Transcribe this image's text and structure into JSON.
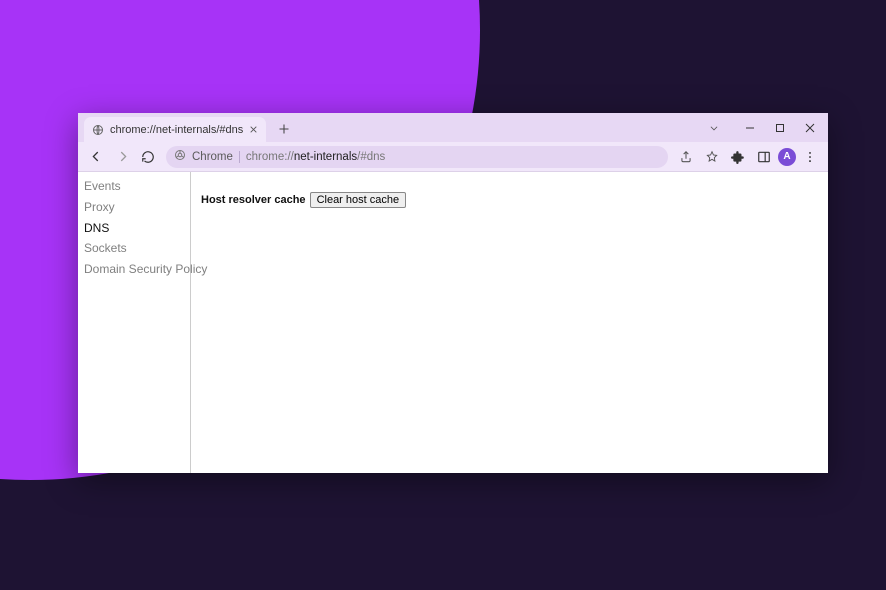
{
  "tab": {
    "title": "chrome://net-internals/#dns"
  },
  "omnibox": {
    "scheme_label": "Chrome",
    "url_prefix": "chrome://",
    "url_host": "net-internals",
    "url_suffix": "/#dns"
  },
  "avatar": {
    "letter": "A"
  },
  "sidebar": {
    "items": [
      {
        "label": "Events",
        "active": false
      },
      {
        "label": "Proxy",
        "active": false
      },
      {
        "label": "DNS",
        "active": true
      },
      {
        "label": "Sockets",
        "active": false
      },
      {
        "label": "Domain Security Policy",
        "active": false
      }
    ]
  },
  "main": {
    "resolver_label": "Host resolver cache",
    "clear_button": "Clear host cache"
  }
}
